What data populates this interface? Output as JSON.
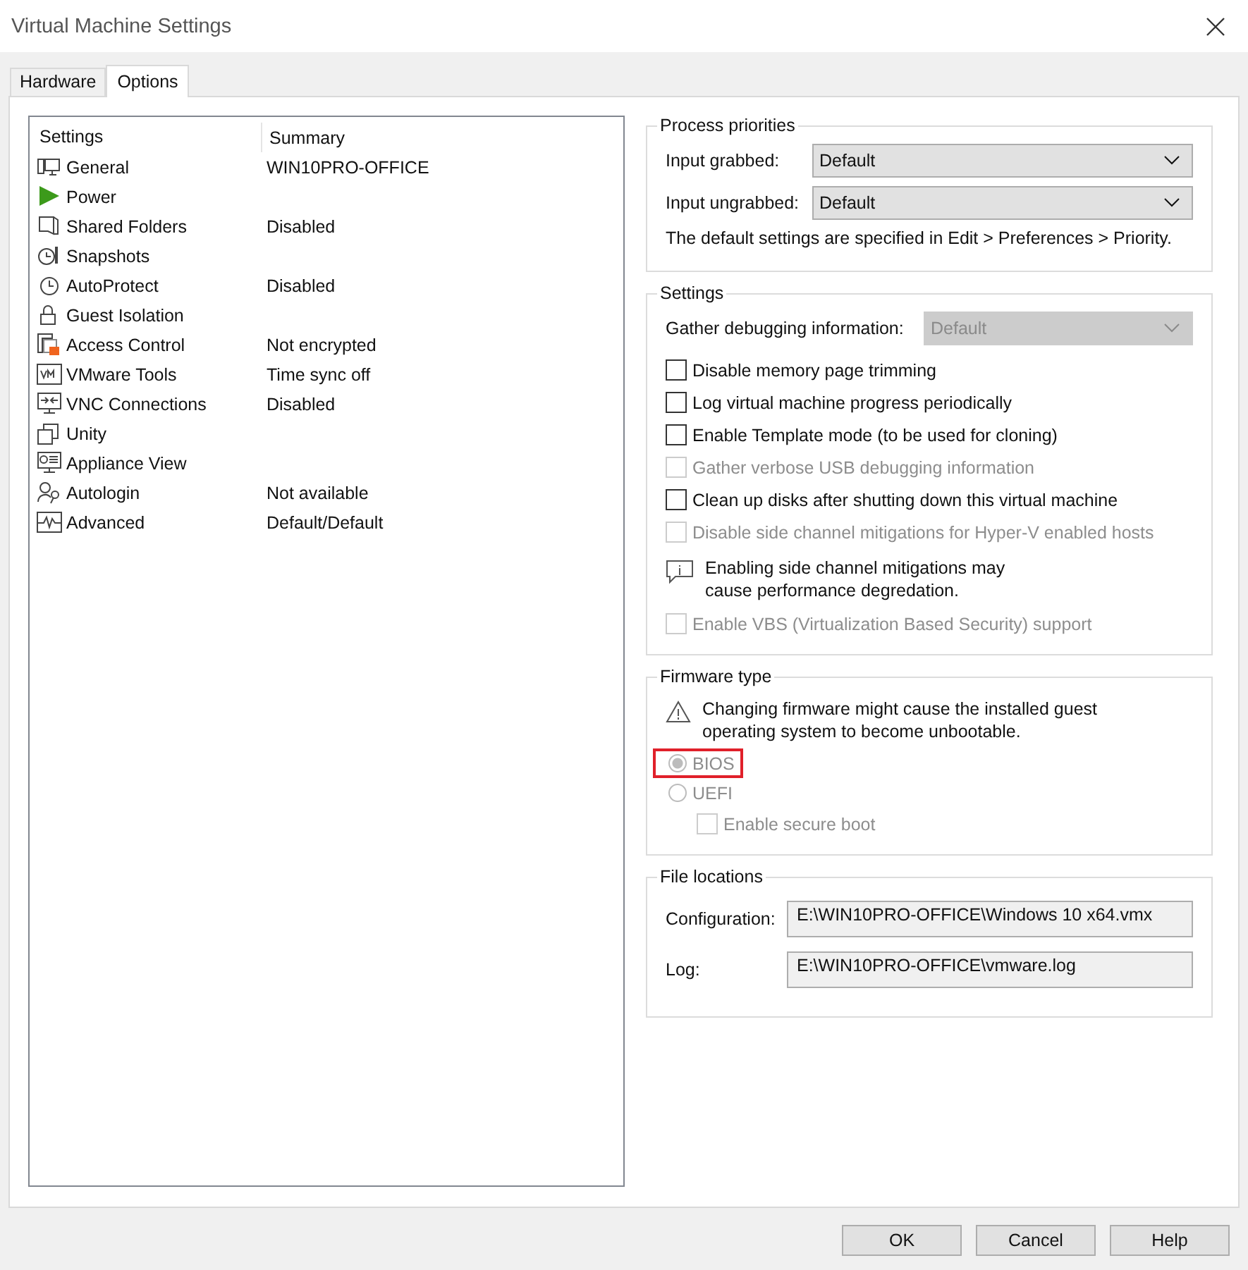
{
  "window": {
    "title": "Virtual Machine Settings"
  },
  "tabs": [
    {
      "label": "Hardware",
      "selected": false
    },
    {
      "label": "Options",
      "selected": true
    }
  ],
  "settings_list": {
    "columns": [
      "Settings",
      "Summary"
    ],
    "rows": [
      {
        "name": "General",
        "summary": "WIN10PRO-OFFICE"
      },
      {
        "name": "Power"
      },
      {
        "name": "Shared Folders",
        "summary": "Disabled"
      },
      {
        "name": "Snapshots"
      },
      {
        "name": "AutoProtect",
        "summary": "Disabled"
      },
      {
        "name": "Guest Isolation"
      },
      {
        "name": "Access Control",
        "summary": "Not encrypted"
      },
      {
        "name": "VMware Tools",
        "summary": "Time sync off"
      },
      {
        "name": "VNC Connections",
        "summary": "Disabled"
      },
      {
        "name": "Unity"
      },
      {
        "name": "Appliance View"
      },
      {
        "name": "Autologin",
        "summary": "Not available"
      },
      {
        "name": "Advanced",
        "summary": "Default/Default"
      }
    ]
  },
  "process_priorities": {
    "title": "Process priorities",
    "fields": [
      {
        "label": "Input grabbed:",
        "value": "Default",
        "disabled": false
      },
      {
        "label": "Input ungrabbed:",
        "value": "Default",
        "disabled": false
      }
    ],
    "note": "The default settings are specified in Edit > Preferences > Priority."
  },
  "settings": {
    "title": "Settings",
    "debug_field": {
      "label": "Gather debugging information:",
      "value": "Default",
      "disabled": true
    },
    "items": [
      {
        "kind": "checkbox",
        "label": "Disable memory page trimming",
        "checked": false,
        "disabled": false
      },
      {
        "kind": "checkbox",
        "label": "Log virtual machine progress periodically",
        "checked": false,
        "disabled": false
      },
      {
        "kind": "checkbox",
        "label": "Enable Template mode (to be used for cloning)",
        "checked": false,
        "disabled": false
      },
      {
        "kind": "checkbox",
        "label": "Gather verbose USB debugging information",
        "checked": false,
        "disabled": true
      },
      {
        "kind": "checkbox",
        "label": "Clean up disks after shutting down this virtual machine",
        "checked": false,
        "disabled": false
      },
      {
        "kind": "checkbox",
        "label": "Disable side channel mitigations for Hyper-V enabled hosts",
        "checked": false,
        "disabled": true
      },
      {
        "kind": "info",
        "label": "Enabling side channel mitigations may\ncause performance degredation."
      },
      {
        "kind": "checkbox",
        "label": "Enable VBS (Virtualization Based Security) support",
        "checked": false,
        "disabled": true
      }
    ]
  },
  "firmware": {
    "title": "Firmware type",
    "warning": "Changing firmware might cause the installed guest\noperating system to become unbootable.",
    "options": [
      {
        "label": "BIOS",
        "selected": true,
        "disabled": true,
        "highlighted": true
      },
      {
        "label": "UEFI",
        "selected": false,
        "disabled": true,
        "highlighted": false
      }
    ],
    "secure_boot": {
      "label": "Enable secure boot",
      "checked": false,
      "disabled": true
    }
  },
  "file_locations": {
    "title": "File locations",
    "fields": [
      {
        "label": "Configuration:",
        "value": "E:\\WIN10PRO-OFFICE\\Windows 10 x64.vmx"
      },
      {
        "label": "Log:",
        "value": "E:\\WIN10PRO-OFFICE\\vmware.log"
      }
    ]
  },
  "buttons": [
    "OK",
    "Cancel",
    "Help"
  ]
}
